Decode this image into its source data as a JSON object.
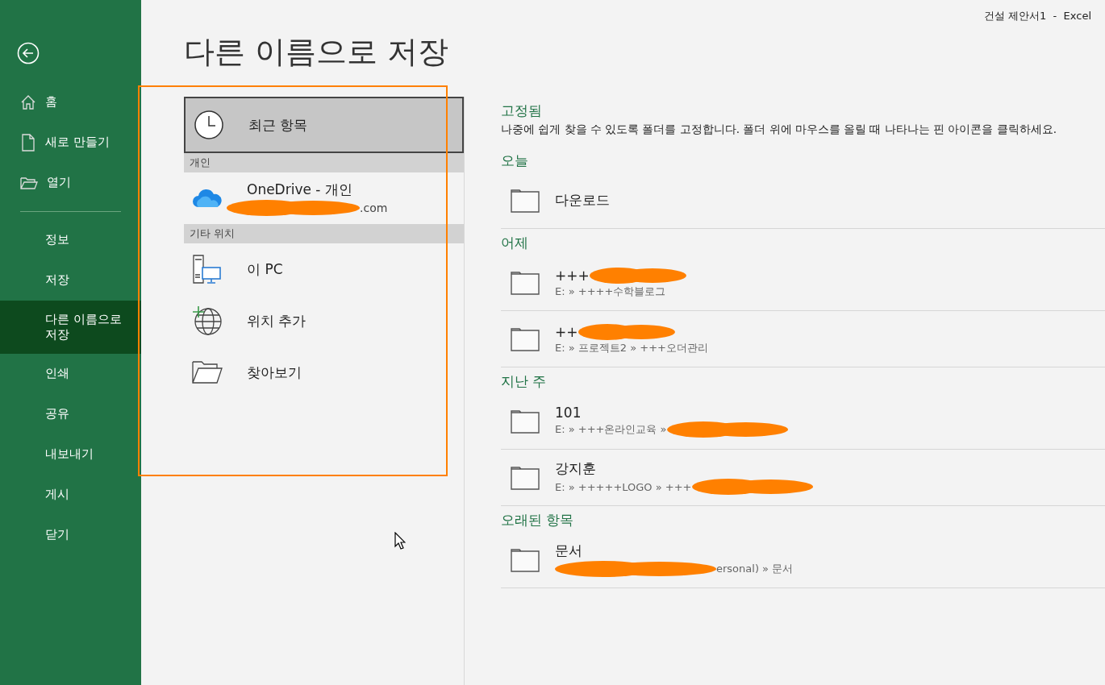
{
  "window": {
    "title": "건설 제안서1  -  Excel"
  },
  "sidebar": {
    "top_items": [
      {
        "label": "홈",
        "selected": false
      },
      {
        "label": "새로 만들기",
        "selected": false
      },
      {
        "label": "열기",
        "selected": false
      }
    ],
    "items": [
      {
        "label": "정보",
        "selected": false
      },
      {
        "label": "저장",
        "selected": false
      },
      {
        "label": "다른 이름으로 저장",
        "selected": true
      },
      {
        "label": "인쇄",
        "selected": false
      },
      {
        "label": "공유",
        "selected": false
      },
      {
        "label": "내보내기",
        "selected": false
      },
      {
        "label": "게시",
        "selected": false
      },
      {
        "label": "닫기",
        "selected": false
      }
    ]
  },
  "page_title": "다른 이름으로 저장",
  "locations": [
    {
      "kind": "recent",
      "label": "최근 항목",
      "selected": true
    },
    {
      "kind": "header",
      "label": "개인"
    },
    {
      "kind": "cloud",
      "label": "OneDrive - 개인",
      "detail": ".com",
      "selected": false
    },
    {
      "kind": "header",
      "label": "기타 위치"
    },
    {
      "kind": "pc",
      "label": "이 PC",
      "selected": false
    },
    {
      "kind": "add",
      "label": "위치 추가",
      "selected": false
    },
    {
      "kind": "browse",
      "label": "찾아보기",
      "selected": false
    }
  ],
  "pinned": {
    "title": "고정됨",
    "hint": "나중에 쉽게 찾을 수 있도록 폴더를 고정합니다. 폴더 위에 마우스를 올릴 때 나타나는 핀 아이콘을 클릭하세요."
  },
  "groups": [
    {
      "title": "오늘",
      "folders": [
        {
          "name": "다운로드"
        }
      ]
    },
    {
      "title": "어제",
      "folders": [
        {
          "name": "+++",
          "name_redacted": true,
          "path": "E: » ++++수학블로그"
        },
        {
          "name": "++",
          "name_redacted": true,
          "path": "E: » 프로젝트2 » +++오더관리"
        }
      ]
    },
    {
      "title": "지난 주",
      "folders": [
        {
          "name": "101",
          "path": "E: » +++온라인교육 »",
          "path_redacted_after": true
        },
        {
          "name": "강지훈",
          "path": "E: » +++++LOGO » +++",
          "path_redacted_after": true
        }
      ]
    },
    {
      "title": "오래된 항목",
      "folders": [
        {
          "name": "문서",
          "path": "ersonal) » 문서",
          "path_redacted_before": true
        }
      ]
    }
  ]
}
